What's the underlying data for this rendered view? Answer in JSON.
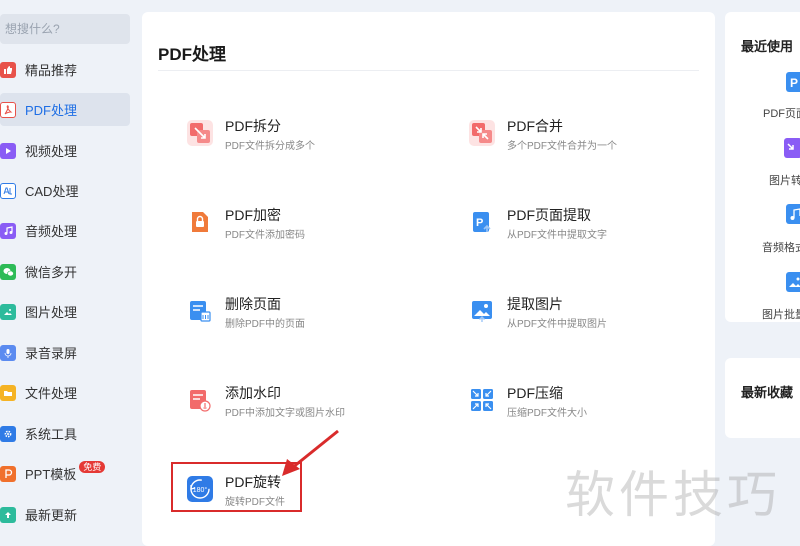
{
  "search": {
    "placeholder": "想搜什么?"
  },
  "sidebar": {
    "items": [
      {
        "label": "精品推荐",
        "icon": "thumbs-up-icon",
        "color": "#e8524a"
      },
      {
        "label": "PDF处理",
        "icon": "pdf-icon",
        "color": "#e8524a",
        "active": true
      },
      {
        "label": "视频处理",
        "icon": "play-icon",
        "color": "#8a5cf5"
      },
      {
        "label": "CAD处理",
        "icon": "cad-icon",
        "color": "#2f7be6"
      },
      {
        "label": "音频处理",
        "icon": "music-icon",
        "color": "#8a5cf5"
      },
      {
        "label": "微信多开",
        "icon": "wechat-icon",
        "color": "#2dbb57"
      },
      {
        "label": "图片处理",
        "icon": "image-icon",
        "color": "#2dbb9c"
      },
      {
        "label": "录音录屏",
        "icon": "microphone-icon",
        "color": "#5b8bf0"
      },
      {
        "label": "文件处理",
        "icon": "folder-icon",
        "color": "#f5b324"
      },
      {
        "label": "系统工具",
        "icon": "gear-icon",
        "color": "#2f7be6"
      },
      {
        "label": "PPT模板",
        "icon": "ppt-icon",
        "color": "#f0702c",
        "badge": "免费"
      },
      {
        "label": "最新更新",
        "icon": "upload-icon",
        "color": "#2dbb9c"
      }
    ]
  },
  "main": {
    "title": "PDF处理",
    "tools": [
      {
        "name": "PDF拆分",
        "desc": "PDF文件拆分成多个",
        "icon": "split-icon",
        "color": "#f26b6b"
      },
      {
        "name": "PDF合并",
        "desc": "多个PDF文件合并为一个",
        "icon": "merge-icon",
        "color": "#f26b6b"
      },
      {
        "name": "PDF加密",
        "desc": "PDF文件添加密码",
        "icon": "lock-icon",
        "color": "#f07a3a"
      },
      {
        "name": "PDF页面提取",
        "desc": "从PDF文件中提取文字",
        "icon": "page-extract-icon",
        "color": "#3a8ff0"
      },
      {
        "name": "删除页面",
        "desc": "删除PDF中的页面",
        "icon": "delete-page-icon",
        "color": "#3a8ff0"
      },
      {
        "name": "提取图片",
        "desc": "从PDF文件中提取图片",
        "icon": "image-extract-icon",
        "color": "#3a8ff0"
      },
      {
        "name": "添加水印",
        "desc": "PDF中添加文字或图片水印",
        "icon": "watermark-icon",
        "color": "#f26b6b"
      },
      {
        "name": "PDF压缩",
        "desc": "压缩PDF文件大小",
        "icon": "compress-icon",
        "color": "#3a8ff0"
      },
      {
        "name": "PDF旋转",
        "desc": "旋转PDF文件",
        "icon": "rotate-icon",
        "color": "#2f7be6",
        "icon_text": "180°"
      }
    ]
  },
  "right": {
    "recent_title": "最近使用",
    "recent": [
      {
        "label": "PDF页面",
        "icon": "pdf-page-icon",
        "color": "#3a8ff0"
      },
      {
        "label": "图片转",
        "icon": "image-convert-icon",
        "color": "#8a5cf5"
      },
      {
        "label": "音频格式",
        "icon": "audio-format-icon",
        "color": "#3a8ff0"
      },
      {
        "label": "图片批量",
        "icon": "image-batch-icon",
        "color": "#3a8ff0"
      }
    ],
    "favorites_title": "最新收藏"
  },
  "watermark": "软件技巧",
  "accent": "#1f6fe5",
  "highlight_color": "#d92b2b"
}
